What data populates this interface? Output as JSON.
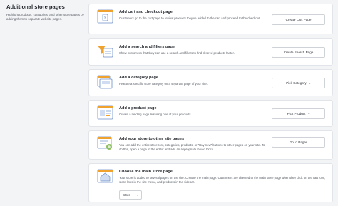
{
  "intro": {
    "title": "Additional store pages",
    "description": "Highlight products, categories, and other store pages by adding them to separate website pages."
  },
  "cards": [
    {
      "title": "Add cart and checkout page",
      "description": "Customers go to the cart page to review products they've added to the cart and proceed to the checkout.",
      "button": "Create Cart Page",
      "icon": "cart-page-icon"
    },
    {
      "title": "Add a search and filters page",
      "description": "Show customers that they can use a search and filters to find desired products faster.",
      "button": "Create Search Page",
      "icon": "search-filter-icon"
    },
    {
      "title": "Add a category page",
      "description": "Feature a specific store category on a separate page of your site.",
      "button": "Pick Category",
      "icon": "category-page-icon"
    },
    {
      "title": "Add a product page",
      "description": "Create a landing page featuring one of your products.",
      "button": "Pick Product",
      "icon": "product-page-icon"
    },
    {
      "title": "Add your store to other site pages",
      "description": "You can add the entire storefront, categories, products, or \"Buy now\" buttons to other pages on your site. To do this, open a page in the editor and add an appropriate Ecwid block.",
      "button": "Go to Pages",
      "icon": "add-store-icon"
    },
    {
      "title": "Choose the main store page",
      "description": "Your store is added to several pages on the site. Choose the main page. Customers are directed to the main store page when they click on the cart icon, store links in the site menu, and products in the sidebar.",
      "select_value": "Store",
      "icon": "main-page-icon"
    }
  ],
  "colors": {
    "accent": "#f0a22e",
    "icon_blue": "#6b8fc9",
    "border": "#e1e4e8"
  }
}
